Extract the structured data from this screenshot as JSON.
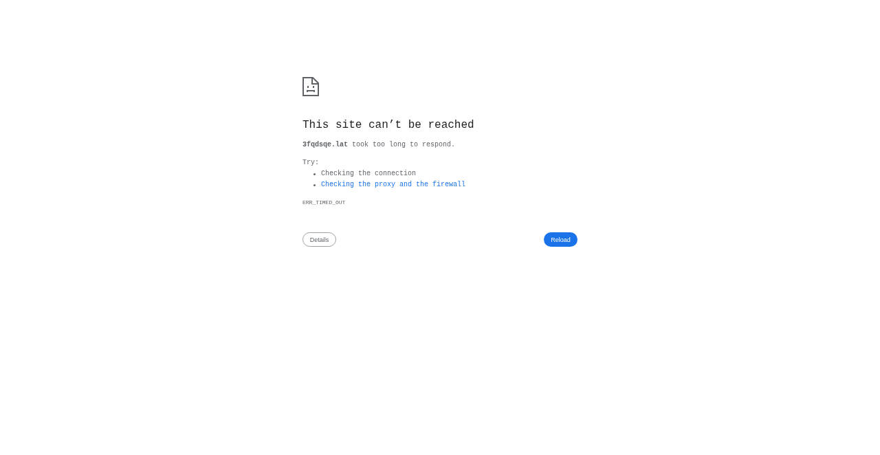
{
  "title": "This site can’t be reached",
  "message": "**3fqdsqe.lat** took too long to respond.",
  "suggestions": {
    "label": "Try:",
    "items": [
      {
        "kind": "text",
        "text": "Checking the connection"
      },
      {
        "kind": "link",
        "text": "Checking the proxy and the firewall"
      }
    ]
  },
  "error_code": "ERR_TIMED_OUT",
  "buttons": [
    {
      "kind": "secondary",
      "label": "Details"
    },
    {
      "kind": "primary",
      "label": "Reload"
    }
  ]
}
